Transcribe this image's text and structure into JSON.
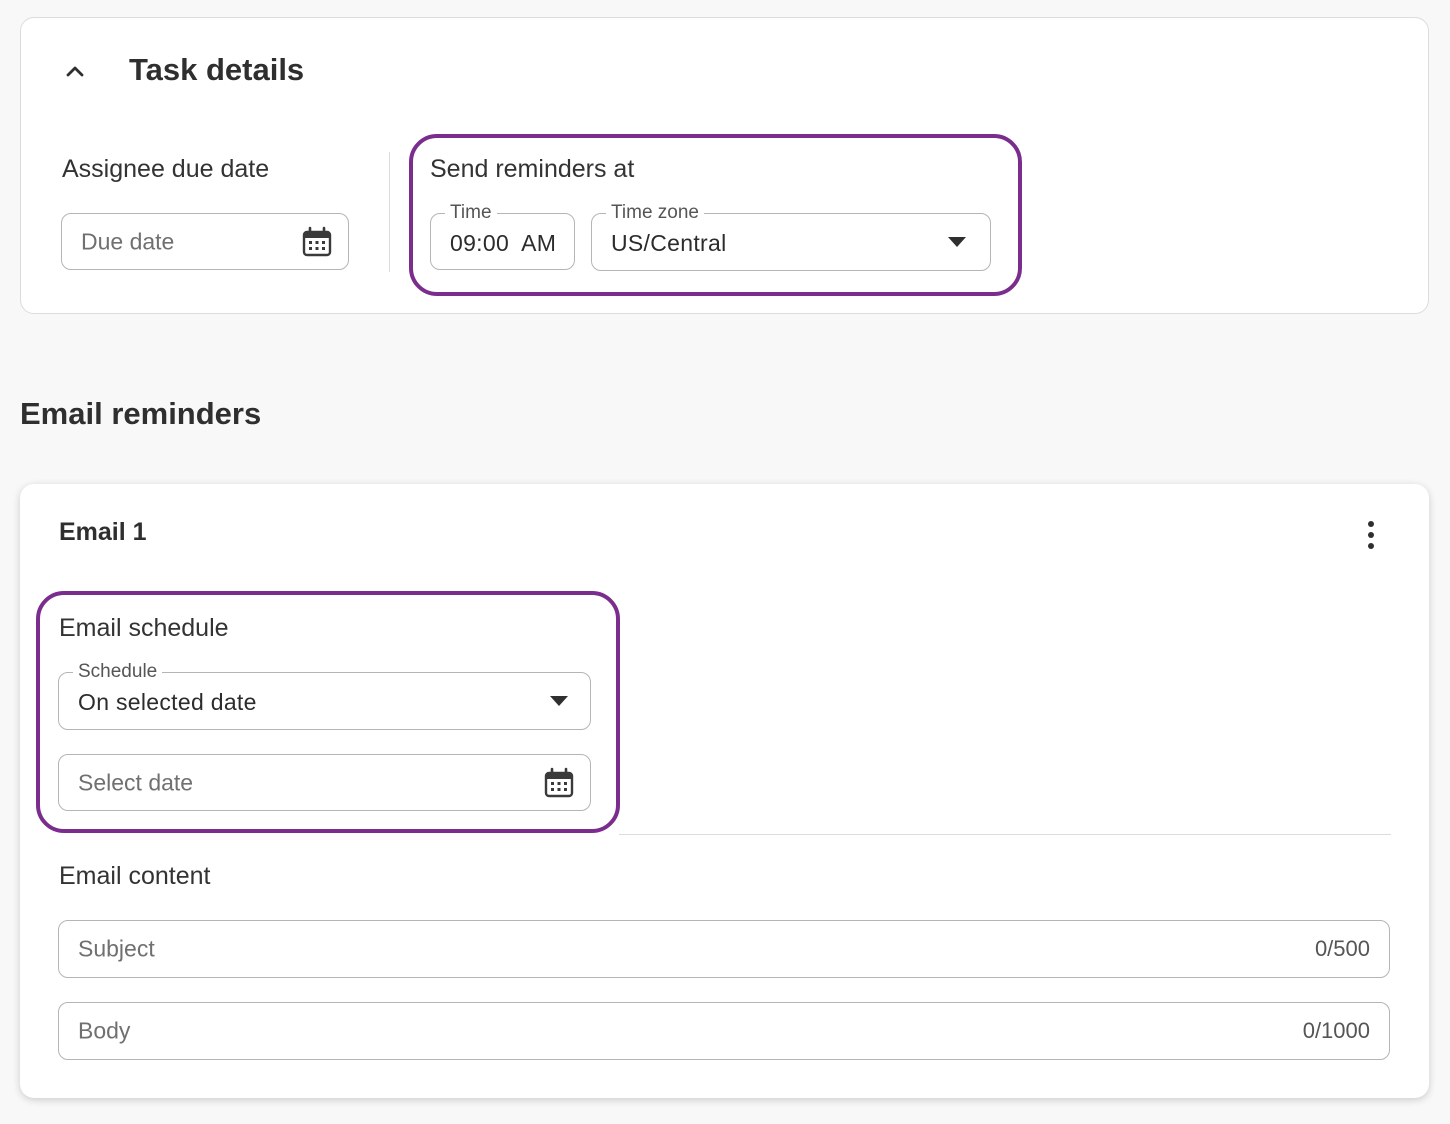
{
  "task_details": {
    "title": "Task details",
    "assignee_due_date": {
      "label": "Assignee due date",
      "placeholder": "Due date"
    },
    "send_reminders": {
      "label": "Send reminders at",
      "time": {
        "legend": "Time",
        "value": "09:00  AM"
      },
      "time_zone": {
        "legend": "Time zone",
        "value": "US/Central"
      }
    }
  },
  "email_reminders": {
    "heading": "Email reminders",
    "emails": [
      {
        "title": "Email 1",
        "schedule": {
          "label": "Email schedule",
          "schedule_select": {
            "legend": "Schedule",
            "value": "On selected date"
          },
          "date_placeholder": "Select date"
        },
        "content": {
          "label": "Email content",
          "subject": {
            "placeholder": "Subject",
            "counter": "0/500"
          },
          "body": {
            "placeholder": "Body",
            "counter": "0/1000"
          }
        }
      }
    ]
  },
  "colors": {
    "highlight": "#7b2d8e",
    "background": "#f8f8f8",
    "card": "#ffffff",
    "border": "#b5b5b5"
  }
}
